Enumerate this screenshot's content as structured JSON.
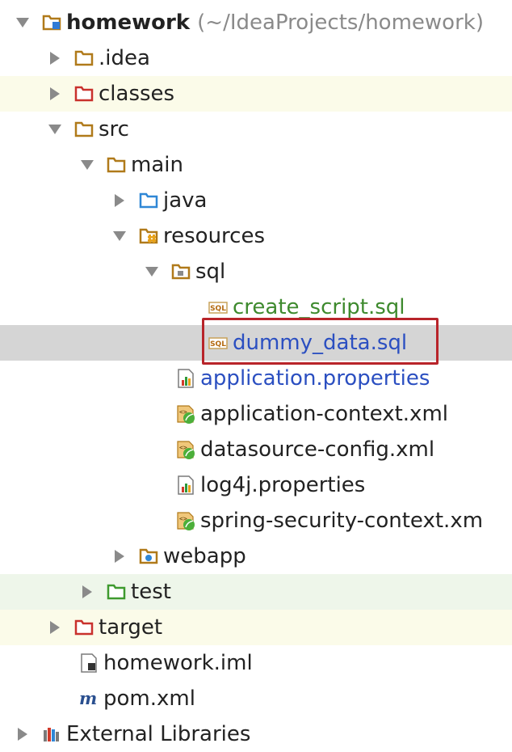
{
  "tree": {
    "root": {
      "label": "homework",
      "path": "(~/IdeaProjects/homework)"
    },
    "items": [
      {
        "label": ".idea"
      },
      {
        "label": "classes"
      },
      {
        "label": "src"
      },
      {
        "label": "main"
      },
      {
        "label": "java"
      },
      {
        "label": "resources"
      },
      {
        "label": "sql"
      },
      {
        "label": "create_script.sql"
      },
      {
        "label": "dummy_data.sql"
      },
      {
        "label": "application.properties"
      },
      {
        "label": "application-context.xml"
      },
      {
        "label": "datasource-config.xml"
      },
      {
        "label": "log4j.properties"
      },
      {
        "label": "spring-security-context.xm"
      },
      {
        "label": "webapp"
      },
      {
        "label": "test"
      },
      {
        "label": "target"
      },
      {
        "label": "homework.iml"
      },
      {
        "label": "pom.xml"
      },
      {
        "label": "External Libraries"
      }
    ]
  },
  "icons": {
    "module": "module-folder-icon",
    "folder": "folder-icon",
    "excluded": "excluded-folder-icon",
    "source": "source-folder-icon",
    "resources": "resources-folder-icon",
    "package": "package-folder-icon",
    "sql": "sql-file-icon",
    "properties": "properties-file-icon",
    "xml": "spring-xml-file-icon",
    "web": "web-folder-icon",
    "test": "test-folder-icon",
    "iml": "iml-file-icon",
    "maven": "maven-pom-icon",
    "libraries": "libraries-icon"
  },
  "colors": {
    "selected_row": "#d5d5d5",
    "excluded_row": "#fbfbe9",
    "test_row": "#eef6ea",
    "highlight_border": "#b8242a",
    "green_text": "#3e8a2e",
    "blue_text": "#2b4fc1"
  }
}
